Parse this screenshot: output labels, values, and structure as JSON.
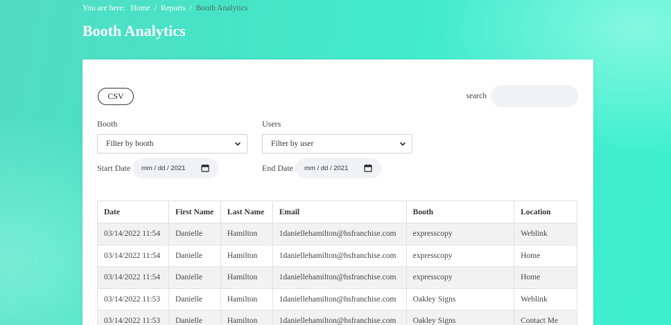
{
  "breadcrumb": {
    "lead": "You are here:",
    "items": [
      "Home",
      "Reports"
    ],
    "current": "Booth Analytics"
  },
  "page_title": "Booth Analytics",
  "toolbar": {
    "csv_label": "CSV",
    "search_label": "search",
    "search_value": ""
  },
  "filters": {
    "booth_label": "Booth",
    "booth_selected": "Filter by booth",
    "users_label": "Users",
    "users_selected": "Filter by user",
    "start_label": "Start Date",
    "start_value": "mm / dd / 2021",
    "end_label": "End Date",
    "end_value": "mm / dd / 2021"
  },
  "table": {
    "columns": [
      "Date",
      "First Name",
      "Last Name",
      "Email",
      "Booth",
      "Location"
    ],
    "rows": [
      [
        "03/14/2022 11:54",
        "Danielle",
        "Hamilton",
        "1daniellehamilton@hsfranchise.com",
        "expresscopy",
        "Weblink"
      ],
      [
        "03/14/2022 11:54",
        "Danielle",
        "Hamilton",
        "1daniellehamilton@hsfranchise.com",
        "expresscopy",
        "Home"
      ],
      [
        "03/14/2022 11:54",
        "Danielle",
        "Hamilton",
        "1daniellehamilton@hsfranchise.com",
        "expresscopy",
        "Home"
      ],
      [
        "03/14/2022 11:53",
        "Danielle",
        "Hamilton",
        "1daniellehamilton@hsfranchise.com",
        "Oakley Signs",
        "Weblink"
      ],
      [
        "03/14/2022 11:53",
        "Danielle",
        "Hamilton",
        "1daniellehamilton@hsfranchise.com",
        "Oakley Signs",
        "Contact Me"
      ]
    ]
  },
  "icons": {
    "select_arrow": "chevron-down-icon",
    "date_picker": "calendar-icon"
  }
}
